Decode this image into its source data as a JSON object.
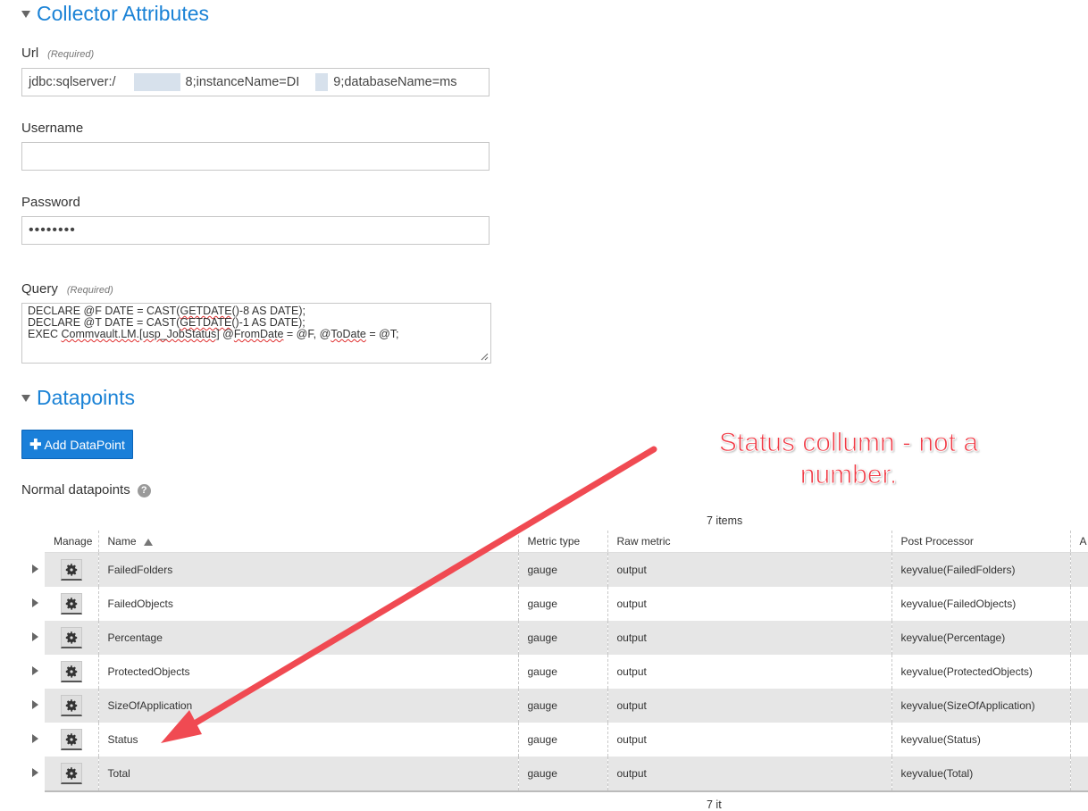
{
  "collector": {
    "section_title": "Collector Attributes",
    "url": {
      "label": "Url",
      "required": "(Required)",
      "value_part1": "jdbc:sqlserver:/",
      "value_part2": "8;instanceName=DI",
      "value_part3": "9;databaseName=ms"
    },
    "username": {
      "label": "Username",
      "value": ""
    },
    "password": {
      "label": "Password",
      "value": "••••••••"
    },
    "query": {
      "label": "Query",
      "required": "(Required)",
      "line1_a": "DECLARE @F DATE = CAST(",
      "line1_b": "GETDATE",
      "line1_c": "()-8 AS DATE);",
      "line2_a": "DECLARE @T DATE = CAST(",
      "line2_b": "GETDATE",
      "line2_c": "()-1 AS DATE);",
      "line3_a": "EXEC ",
      "line3_b": "Commvault.LM.[usp_JobStatus]",
      "line3_c": " @",
      "line3_d": "FromDate",
      "line3_e": " = @F, @",
      "line3_f": "ToDate",
      "line3_g": " = @T;"
    }
  },
  "datapoints": {
    "section_title": "Datapoints",
    "add_button": "Add DataPoint",
    "normal_label": "Normal datapoints",
    "help_glyph": "?",
    "items_count": "7 items",
    "items_count_bottom": "7 it",
    "columns": [
      "Manage",
      "Name",
      "Metric type",
      "Raw metric",
      "Post Processor",
      "A"
    ],
    "rows": [
      {
        "name": "FailedFolders",
        "metric_type": "gauge",
        "raw": "output",
        "post": "keyvalue(FailedFolders)"
      },
      {
        "name": "FailedObjects",
        "metric_type": "gauge",
        "raw": "output",
        "post": "keyvalue(FailedObjects)"
      },
      {
        "name": "Percentage",
        "metric_type": "gauge",
        "raw": "output",
        "post": "keyvalue(Percentage)"
      },
      {
        "name": "ProtectedObjects",
        "metric_type": "gauge",
        "raw": "output",
        "post": "keyvalue(ProtectedObjects)"
      },
      {
        "name": "SizeOfApplication",
        "metric_type": "gauge",
        "raw": "output",
        "post": "keyvalue(SizeOfApplication)"
      },
      {
        "name": "Status",
        "metric_type": "gauge",
        "raw": "output",
        "post": "keyvalue(Status)"
      },
      {
        "name": "Total",
        "metric_type": "gauge",
        "raw": "output",
        "post": "keyvalue(Total)"
      }
    ]
  },
  "annotation": {
    "line1": "Status collumn - not a",
    "line2": "number.",
    "color": "#f03a45"
  },
  "colors": {
    "accent": "#1a82d6",
    "button": "#1a7fd9",
    "row_alt": "#e6e6e6"
  }
}
